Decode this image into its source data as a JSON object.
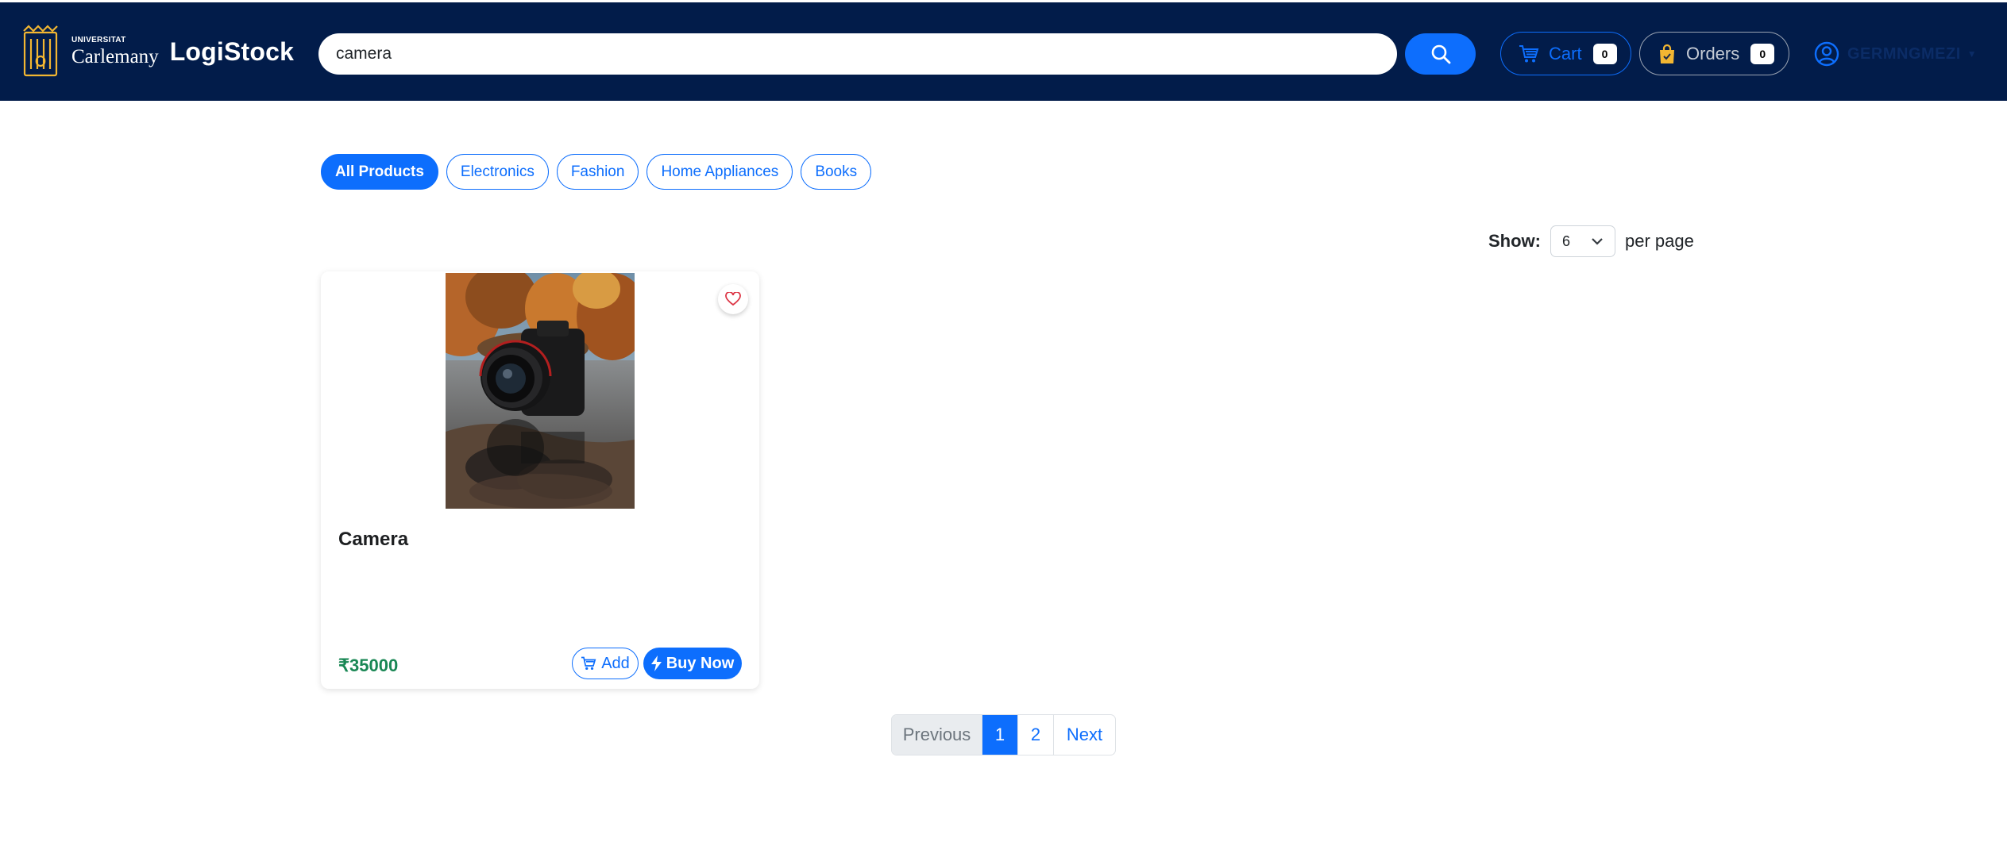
{
  "header": {
    "brand": {
      "university_small": "UNIVERSITAT",
      "university_name": "Carlemany",
      "app_name": "LogiStock"
    },
    "search": {
      "value": "camera",
      "placeholder": ""
    },
    "cart": {
      "label": "Cart",
      "count": "0"
    },
    "orders": {
      "label": "Orders",
      "count": "0"
    },
    "user": {
      "name": "GERMNGMEZI"
    }
  },
  "categories": [
    {
      "label": "All Products",
      "active": true
    },
    {
      "label": "Electronics",
      "active": false
    },
    {
      "label": "Fashion",
      "active": false
    },
    {
      "label": "Home Appliances",
      "active": false
    },
    {
      "label": "Books",
      "active": false
    }
  ],
  "per_page": {
    "show_label": "Show:",
    "value": "6",
    "suffix": "per page"
  },
  "products": [
    {
      "name": "Camera",
      "price": "₹35000",
      "add_label": "Add",
      "buy_label": "Buy Now"
    }
  ],
  "pagination": {
    "previous": "Previous",
    "pages": [
      "1",
      "2"
    ],
    "current": "1",
    "next": "Next"
  },
  "colors": {
    "navbar": "#021c4a",
    "primary": "#0d6efd",
    "price": "#198754",
    "brand_gold": "#f2b632",
    "wishlist": "#dc3545"
  },
  "icons": {
    "search": "search-icon",
    "cart": "cart-icon",
    "orders": "shopping-bag-icon",
    "user": "user-circle-icon",
    "wishlist": "heart-icon",
    "buy": "lightning-icon",
    "select": "chevron-down-icon"
  }
}
